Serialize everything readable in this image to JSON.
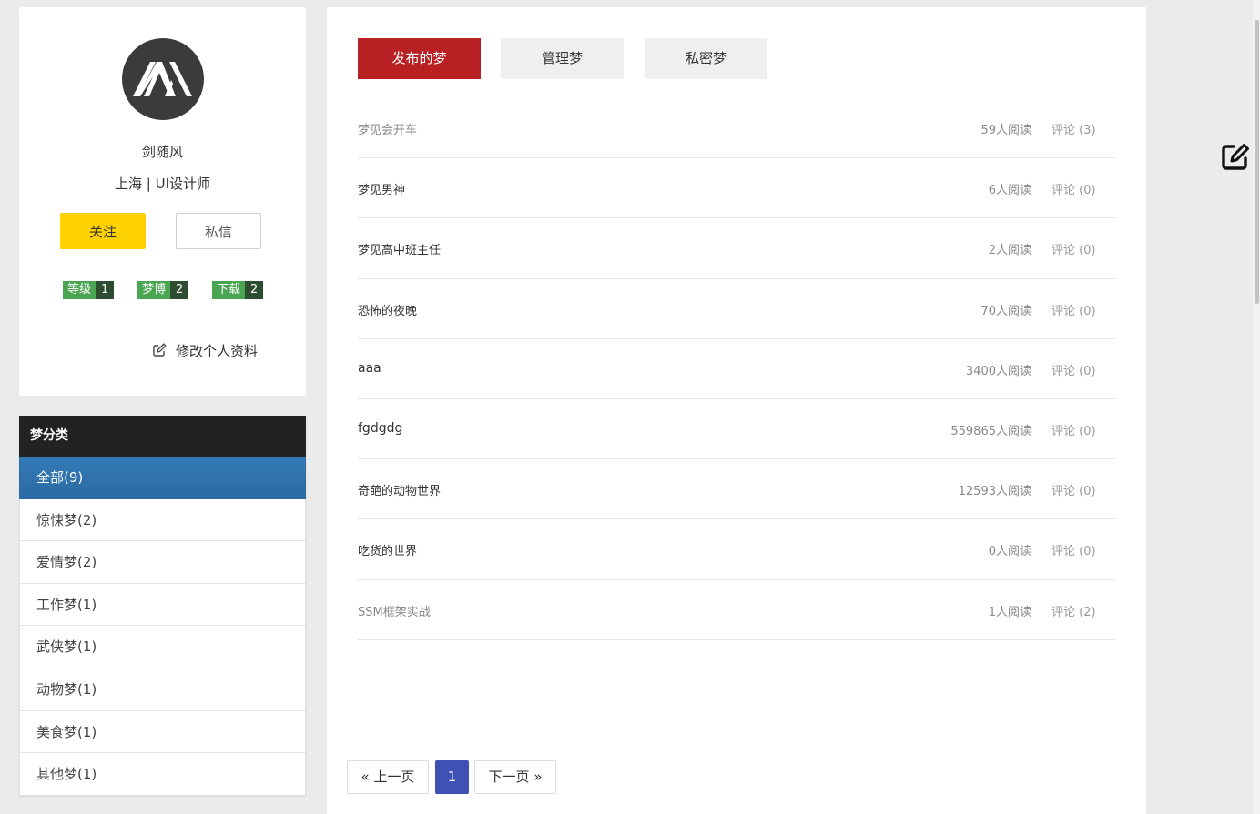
{
  "profile": {
    "name": "剑随风",
    "meta": "上海 | UI设计师",
    "follow_label": "关注",
    "message_label": "私信",
    "badges": [
      {
        "label": "等级",
        "value": "1"
      },
      {
        "label": "梦博",
        "value": "2"
      },
      {
        "label": "下载",
        "value": "2"
      }
    ],
    "edit_label": "修改个人资料"
  },
  "categories": {
    "header": "梦分类",
    "items": [
      {
        "label": "全部(9)",
        "active": true
      },
      {
        "label": "惊悚梦(2)"
      },
      {
        "label": "爱情梦(2)"
      },
      {
        "label": "工作梦(1)"
      },
      {
        "label": "武侠梦(1)"
      },
      {
        "label": "动物梦(1)"
      },
      {
        "label": "美食梦(1)"
      },
      {
        "label": "其他梦(1)"
      }
    ]
  },
  "tabs": [
    {
      "label": "发布的梦",
      "active": true
    },
    {
      "label": "管理梦"
    },
    {
      "label": "私密梦"
    }
  ],
  "dreams": [
    {
      "title": "梦见会开车",
      "reads": "59人阅读",
      "comments": "评论 (3)"
    },
    {
      "title": "梦见男神",
      "reads": "6人阅读",
      "comments": "评论 (0)"
    },
    {
      "title": "梦见高中班主任",
      "reads": "2人阅读",
      "comments": "评论 (0)"
    },
    {
      "title": "恐怖的夜晚",
      "reads": "70人阅读",
      "comments": "评论 (0)"
    },
    {
      "title": "aaa",
      "reads": "3400人阅读",
      "comments": "评论 (0)"
    },
    {
      "title": "fgdgdg",
      "reads": "559865人阅读",
      "comments": "评论 (0)"
    },
    {
      "title": "奇葩的动物世界",
      "reads": "12593人阅读",
      "comments": "评论 (0)"
    },
    {
      "title": "吃货的世界",
      "reads": "0人阅读",
      "comments": "评论 (0)"
    },
    {
      "title": "SSM框架实战",
      "reads": "1人阅读",
      "comments": "评论 (2)"
    }
  ],
  "pagination": {
    "prev": "« 上一页",
    "current": "1",
    "next": "下一页 »"
  },
  "colors": {
    "accent_red": "#b82024",
    "follow_yellow": "#ffd200",
    "category_active": "#337ab7",
    "page_current": "#3f51b5",
    "badge_green": "#4aa553"
  },
  "icons": {
    "avatar": "mountain-logo",
    "edit_profile": "edit-square-icon",
    "floating": "edit-square-icon"
  }
}
